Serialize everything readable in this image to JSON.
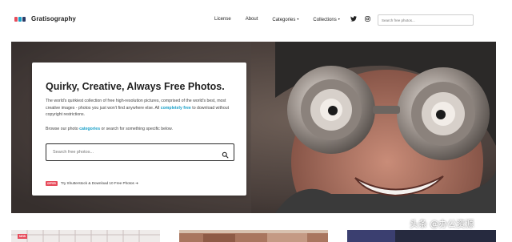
{
  "brand": {
    "name": "Gratisography",
    "colors": [
      "#e74c5c",
      "#1aa0c8",
      "#2b3a67"
    ]
  },
  "nav": {
    "links": [
      {
        "label": "License",
        "caret": ""
      },
      {
        "label": "About",
        "caret": ""
      },
      {
        "label": "Categories",
        "caret": "▾"
      },
      {
        "label": "Collections",
        "caret": "▾"
      }
    ],
    "social_icons": [
      "twitter-icon",
      "instagram-icon"
    ],
    "search_placeholder": "Search free photos..."
  },
  "hero": {
    "title": "Quirky, Creative, Always Free Photos.",
    "desc_before": "The world's quirkiest collection of free high-resolution pictures, comprised of the world's best, most creative images - photos you just won't find anywhere else. All",
    "desc_link": "completely free",
    "desc_after": "to download without copyright restrictions.",
    "browse_before": "Browse our photo",
    "browse_link": "categories",
    "browse_after": "or search for something specific below.",
    "search_placeholder": "Search free photos...",
    "promo_badge": "OFFER",
    "promo_text": "Try Shutterstock & Download 10 Free Photos ➜"
  },
  "thumbnails": {
    "badge": "NEW"
  },
  "watermark": "头条 @办公资源",
  "colors": {
    "accent_link": "#1aa0c8",
    "badge": "#e74c5c",
    "search_border": "#2b2b2b"
  }
}
